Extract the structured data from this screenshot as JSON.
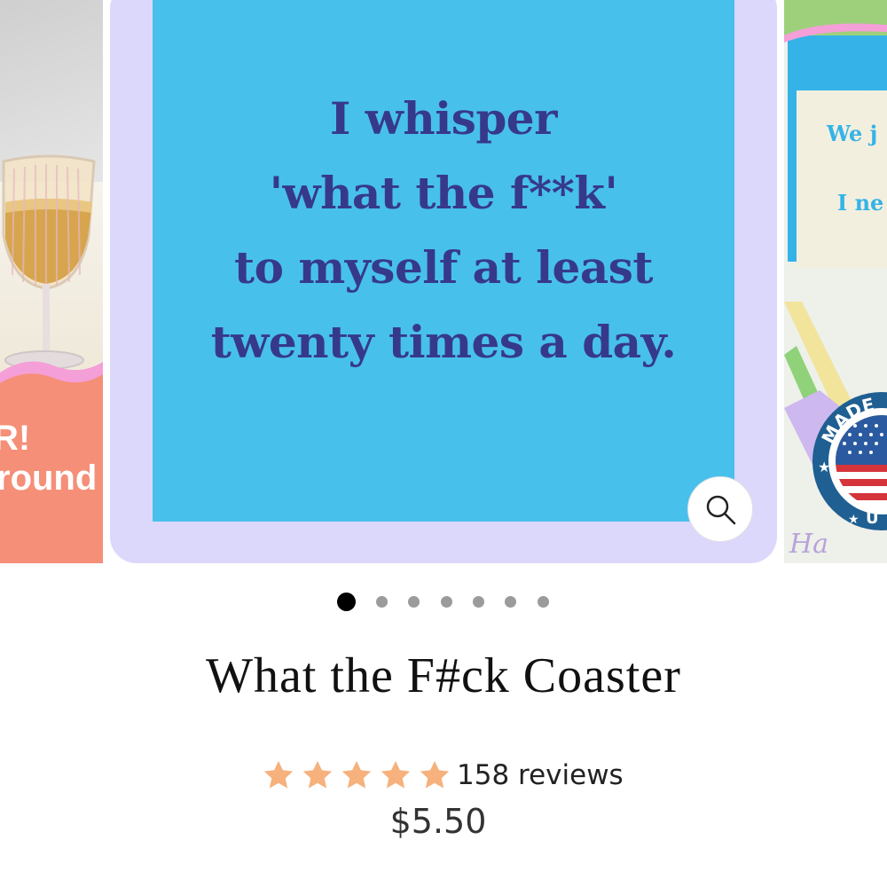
{
  "left_slide": {
    "banner_line1": "R!",
    "banner_line2": "round"
  },
  "main_slide": {
    "quote_lines": [
      "I whisper",
      "'what the f**k'",
      "to myself at least",
      "twenty times a day."
    ],
    "zoom_icon": "magnifier-icon"
  },
  "right_slide": {
    "card_text1": "“",
    "card_text2": "We j",
    "card_text3": "I ne",
    "badge_text": "MADE",
    "badge_text_bottom": "U",
    "handwriting": "Ha"
  },
  "pagination": {
    "count": 7,
    "active_index": 0
  },
  "product": {
    "title": "What the F#ck Coaster",
    "rating": 5,
    "reviews_label": "158 reviews",
    "price": "$5.50"
  },
  "colors": {
    "coaster_blue": "#48c0ec",
    "quote_text": "#36398a",
    "frame_lavender": "#dcd8fb",
    "star": "#f6b17c",
    "banner_coral": "#f58f78"
  }
}
